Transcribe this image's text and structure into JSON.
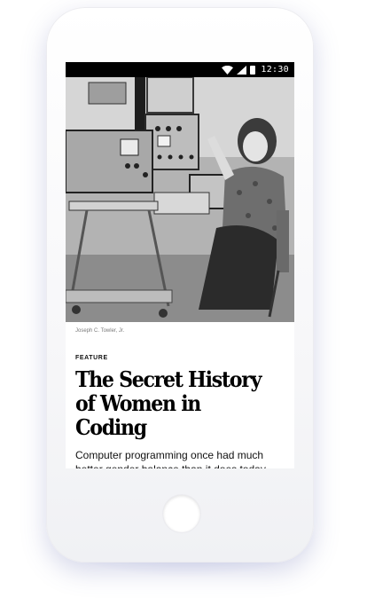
{
  "status_bar": {
    "time": "12:30"
  },
  "article": {
    "photo_credit": "Joseph C. Towler, Jr.",
    "kicker": "FEATURE",
    "headline_line1": "The Secret History",
    "headline_line2": "of Women in Coding",
    "dek": "Computer programming once had much better gender balance than it does today. What went wrong?"
  },
  "icons": {
    "wifi": "wifi-icon",
    "signal": "signal-icon",
    "battery": "battery-icon",
    "home": "home-button"
  }
}
